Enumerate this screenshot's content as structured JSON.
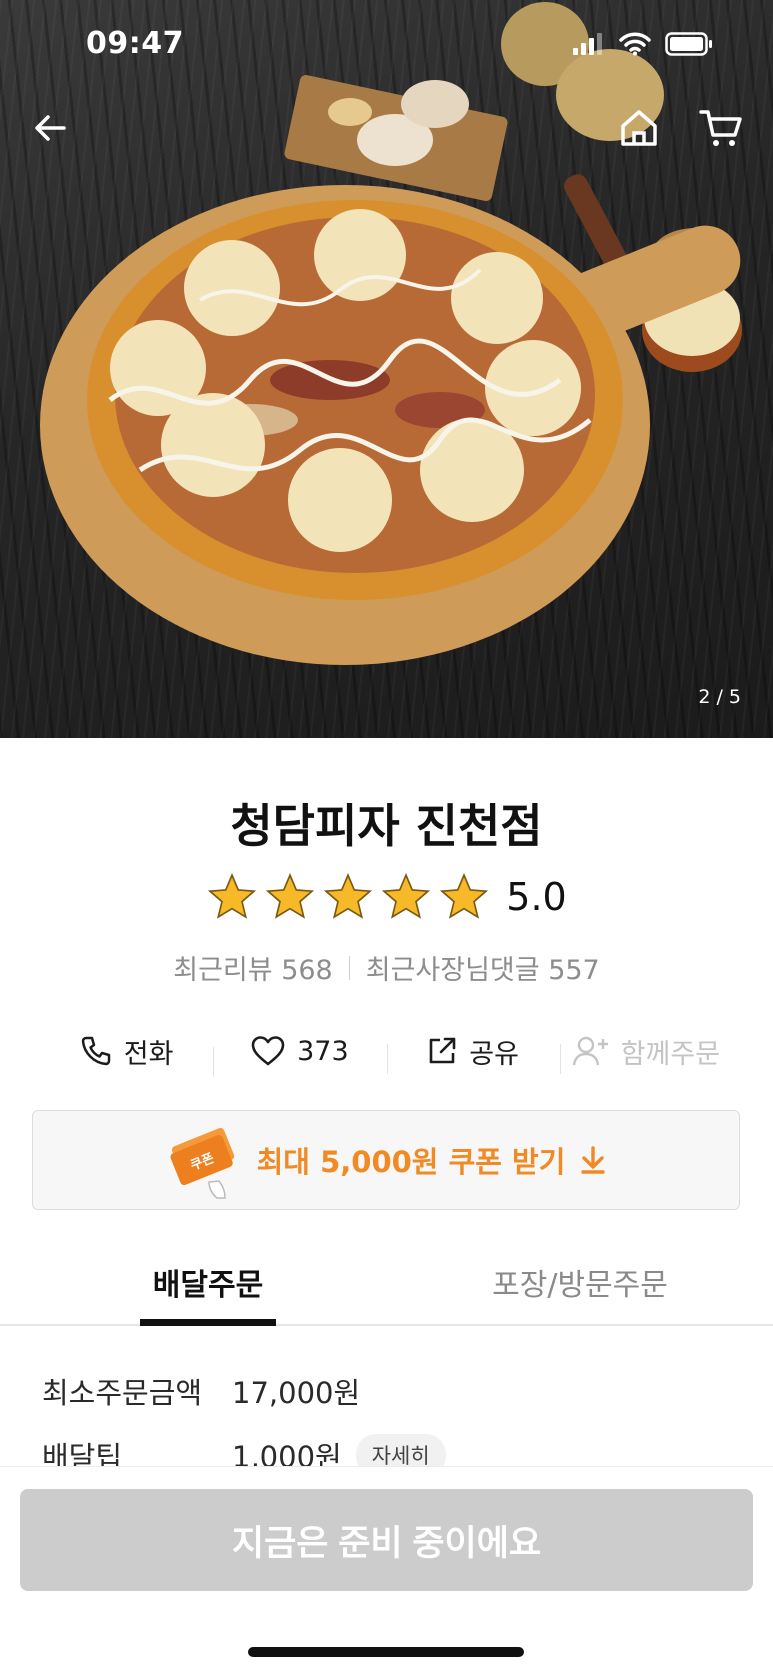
{
  "status_bar": {
    "time": "09:47"
  },
  "hero": {
    "page_indicator": "2 / 5"
  },
  "store": {
    "name": "청담피자 진천점",
    "rating": "5.0",
    "stars": 5,
    "recent_reviews_label": "최근리뷰 568",
    "owner_replies_label": "최근사장님댓글 557"
  },
  "actions": {
    "call": "전화",
    "like_count": "373",
    "share": "공유",
    "group_order": "함께주문"
  },
  "coupon": {
    "label": "최대 5,000원 쿠폰 받기",
    "ticket_text": "쿠폰"
  },
  "tabs": {
    "delivery": "배달주문",
    "pickup": "포장/방문주문"
  },
  "order_info": {
    "min_order_label": "최소주문금액",
    "min_order_value": "17,000원",
    "delivery_tip_label": "배달팁",
    "delivery_tip_value": "1,000원",
    "detail_button": "자세히"
  },
  "cta": {
    "label": "지금은 준비 중이에요"
  },
  "colors": {
    "accent": "#f08a24",
    "star": "#f7b928",
    "cta_disabled": "#cccccc"
  }
}
